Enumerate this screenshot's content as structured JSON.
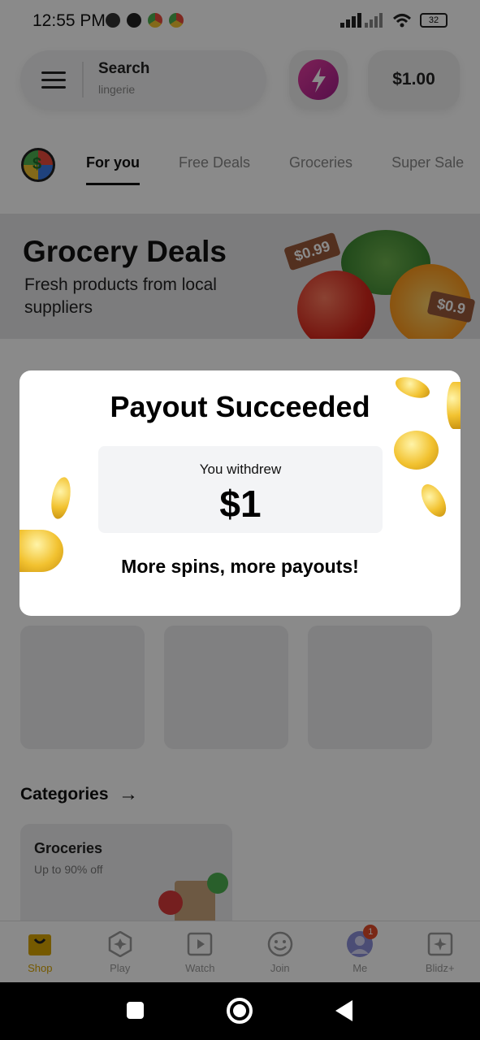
{
  "status_bar": {
    "time": "12:55 PM",
    "battery": "32"
  },
  "header": {
    "search_label": "Search",
    "search_hint": "lingerie",
    "balance": "$1.00"
  },
  "tabs": [
    {
      "label": "For you",
      "active": true
    },
    {
      "label": "Free Deals",
      "active": false
    },
    {
      "label": "Groceries",
      "active": false
    },
    {
      "label": "Super Sale",
      "active": false
    }
  ],
  "banner": {
    "title": "Grocery Deals",
    "subtitle": "Fresh products from local suppliers",
    "price_tag_1": "$0.99",
    "price_tag_2": "$0.9"
  },
  "categories": {
    "title": "Categories",
    "card_title": "Groceries",
    "card_subtitle": "Up to 90% off"
  },
  "bottom_nav": [
    {
      "label": "Shop",
      "icon": "bag-icon",
      "active": true
    },
    {
      "label": "Play",
      "icon": "hexagon-star-icon",
      "active": false
    },
    {
      "label": "Watch",
      "icon": "play-square-icon",
      "active": false
    },
    {
      "label": "Join",
      "icon": "smiley-icon",
      "active": false
    },
    {
      "label": "Me",
      "icon": "avatar-icon",
      "active": false,
      "badge": "1"
    },
    {
      "label": "Blidz+",
      "icon": "sparkle-square-icon",
      "active": false
    }
  ],
  "modal": {
    "title": "Payout Succeeded",
    "withdraw_label": "You withdrew",
    "amount": "$1",
    "cta": "More spins, more payouts!"
  },
  "colors": {
    "accent_yellow": "#d8a400",
    "overlay": "rgba(0,0,0,0.46)",
    "bolt_gradient": "#e63c9f",
    "badge": "#e24b2a"
  }
}
